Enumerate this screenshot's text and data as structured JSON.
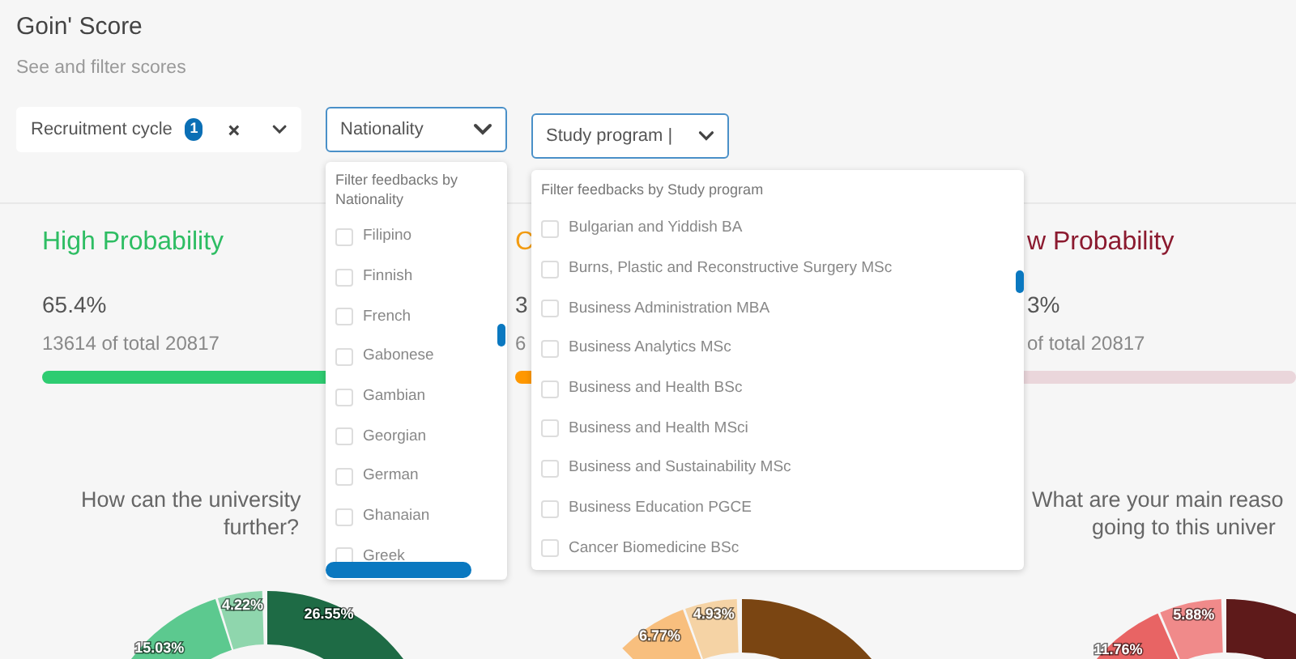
{
  "header": {
    "title": "Goin' Score",
    "subtitle": "See and filter scores"
  },
  "filters": [
    {
      "label": "Recruitment cycle",
      "badge": "1",
      "focused": false,
      "clearable": true
    },
    {
      "label": "Nationality",
      "focused": true,
      "clearable": false
    },
    {
      "label": "Study program |",
      "focused": true,
      "clearable": false
    }
  ],
  "dropdowns": [
    {
      "heading": "Filter feedbacks by Nationality",
      "options": [
        {
          "label": "Filipino",
          "checked": false
        },
        {
          "label": "Finnish",
          "checked": false
        },
        {
          "label": "French",
          "checked": false
        },
        {
          "label": "Gabonese",
          "checked": false
        },
        {
          "label": "Gambian",
          "checked": false
        },
        {
          "label": "Georgian",
          "checked": false
        },
        {
          "label": "German",
          "checked": false
        },
        {
          "label": "Ghanaian",
          "checked": false
        },
        {
          "label": "Greek",
          "checked": false
        }
      ]
    },
    {
      "heading": "Filter feedbacks by Study program",
      "options": [
        {
          "label": "Bulgarian and Yiddish BA",
          "checked": false
        },
        {
          "label": "Burns, Plastic and Reconstructive Surgery MSc",
          "checked": false
        },
        {
          "label": "Business Administration MBA",
          "checked": false
        },
        {
          "label": "Business Analytics MSc",
          "checked": false
        },
        {
          "label": "Business and Health BSc",
          "checked": false
        },
        {
          "label": "Business and Health MSci",
          "checked": false
        },
        {
          "label": "Business and Sustainability MSc",
          "checked": false
        },
        {
          "label": "Business Education PGCE",
          "checked": false
        },
        {
          "label": "Cancer Biomedicine BSc",
          "checked": false
        }
      ]
    }
  ],
  "cards": [
    {
      "kind": "high",
      "title": "High Probability",
      "percent": "65.4%",
      "count": "13614 of total 20817"
    },
    {
      "kind": "medium",
      "title": "C",
      "percent": "3",
      "count": "6"
    },
    {
      "kind": "low",
      "title": "w Probability",
      "percent": "3%",
      "count": "of total 20817"
    }
  ],
  "charts": [
    {
      "question_lines": [
        "How can the university",
        "further?"
      ],
      "segments": [
        {
          "label": "26.55%",
          "color": "#1e6b45"
        },
        {
          "label": "4.22%",
          "color": "#8fd6ad"
        },
        {
          "label": "15.03%",
          "color": "#5cc98f"
        }
      ]
    },
    {
      "segments": [
        {
          "color": "#7a4512"
        },
        {
          "label": "4.93%",
          "color": "#f5d3a5"
        },
        {
          "label": "6.77%",
          "color": "#f8bf7e"
        }
      ]
    },
    {
      "question_lines": [
        "What are your main reaso",
        "going to this univer"
      ],
      "segments": [
        {
          "color": "#5e1a1a"
        },
        {
          "label": "5.88%",
          "color": "#f08a8a"
        },
        {
          "label": "11.76%",
          "color": "#e86464"
        }
      ]
    }
  ]
}
